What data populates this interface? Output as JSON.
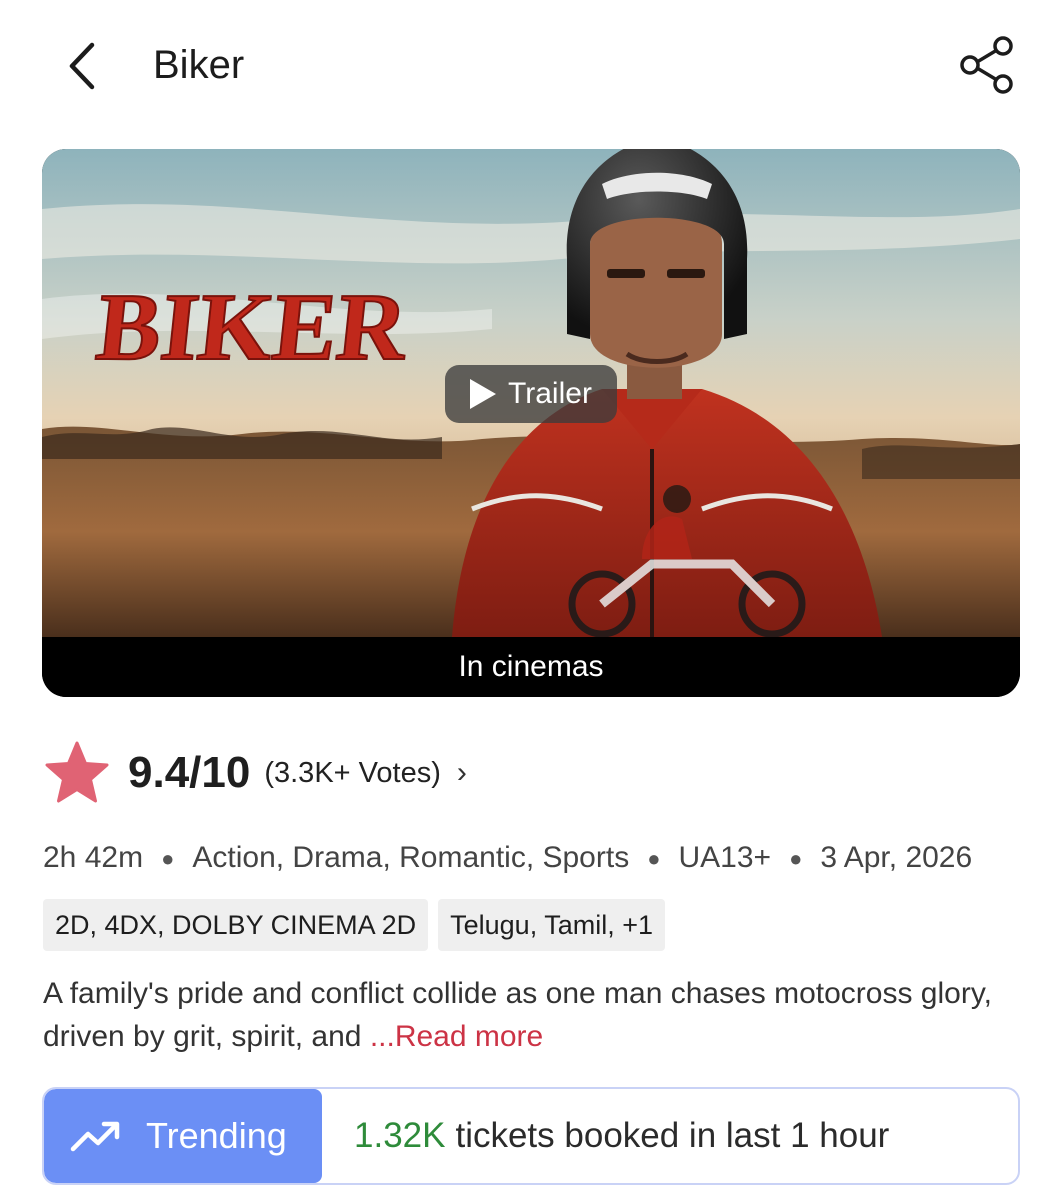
{
  "header": {
    "back_icon": "chevron-left-icon",
    "title": "Biker",
    "share_icon": "share-icon"
  },
  "banner": {
    "poster_title": "BIKER",
    "trailer_label": "Trailer",
    "status_label": "In cinemas"
  },
  "rating": {
    "icon": "star-icon",
    "color": "#e06374",
    "score": "9.4/10",
    "votes": "(3.3K+ Votes)",
    "chevron": "›"
  },
  "meta": {
    "duration": "2h 42m",
    "genres": "Action, Drama, Romantic, Sports",
    "certificate": "UA13+",
    "release_date": "3 Apr, 2026"
  },
  "chips": {
    "formats": "2D, 4DX, DOLBY CINEMA 2D",
    "languages": "Telugu, Tamil, +1"
  },
  "description": {
    "text": "A family's pride and conflict collide as one man chases motocross glory, driven by grit, spirit, and ",
    "read_more": "...Read more"
  },
  "trending": {
    "icon": "trending-up-icon",
    "label": "Trending",
    "count": "1.32K",
    "text": "tickets booked in last 1 hour",
    "accent": "#6b8ff5",
    "count_color": "#2e8b3a"
  }
}
